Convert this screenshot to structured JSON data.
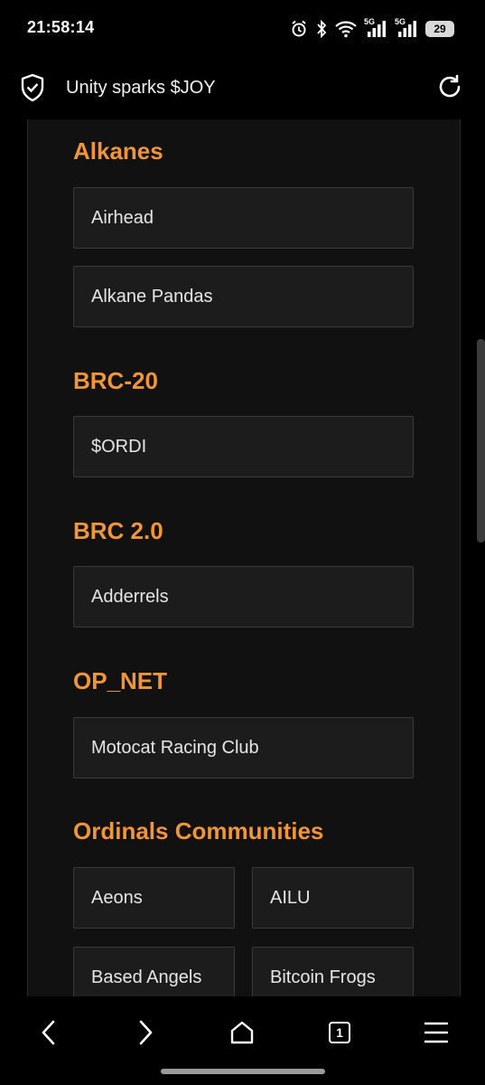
{
  "status_bar": {
    "time": "21:58:14",
    "icons": [
      "alarm-icon",
      "bluetooth-icon",
      "wifi-icon",
      "signal-5g-icon",
      "signal-5g-icon"
    ],
    "network_label_1": "5G",
    "network_label_2": "5G",
    "battery": "29"
  },
  "browser": {
    "page_title": "Unity sparks $JOY",
    "icons": [
      "shield-check-icon",
      "reload-icon"
    ]
  },
  "sections": [
    {
      "title": "Alkanes",
      "items": [
        "Airhead",
        "Alkane Pandas"
      ]
    },
    {
      "title": "BRC-20",
      "items": [
        "$ORDI"
      ]
    },
    {
      "title": "BRC 2.0",
      "items": [
        "Adderrels"
      ]
    },
    {
      "title": "OP_NET",
      "items": [
        "Motocat Racing Club"
      ]
    },
    {
      "title": "Ordinals Communities",
      "items": [
        "Aeons",
        "AILU",
        "Based Angels",
        "Bitcoin Frogs"
      ]
    }
  ],
  "nav": {
    "tab_count": "1",
    "icons": [
      "back-icon",
      "forward-icon",
      "home-icon",
      "tabs-icon",
      "menu-icon"
    ]
  },
  "colors": {
    "accent": "#f0953a",
    "card_bg": "#1c1c1c",
    "page_bg": "#111111"
  }
}
